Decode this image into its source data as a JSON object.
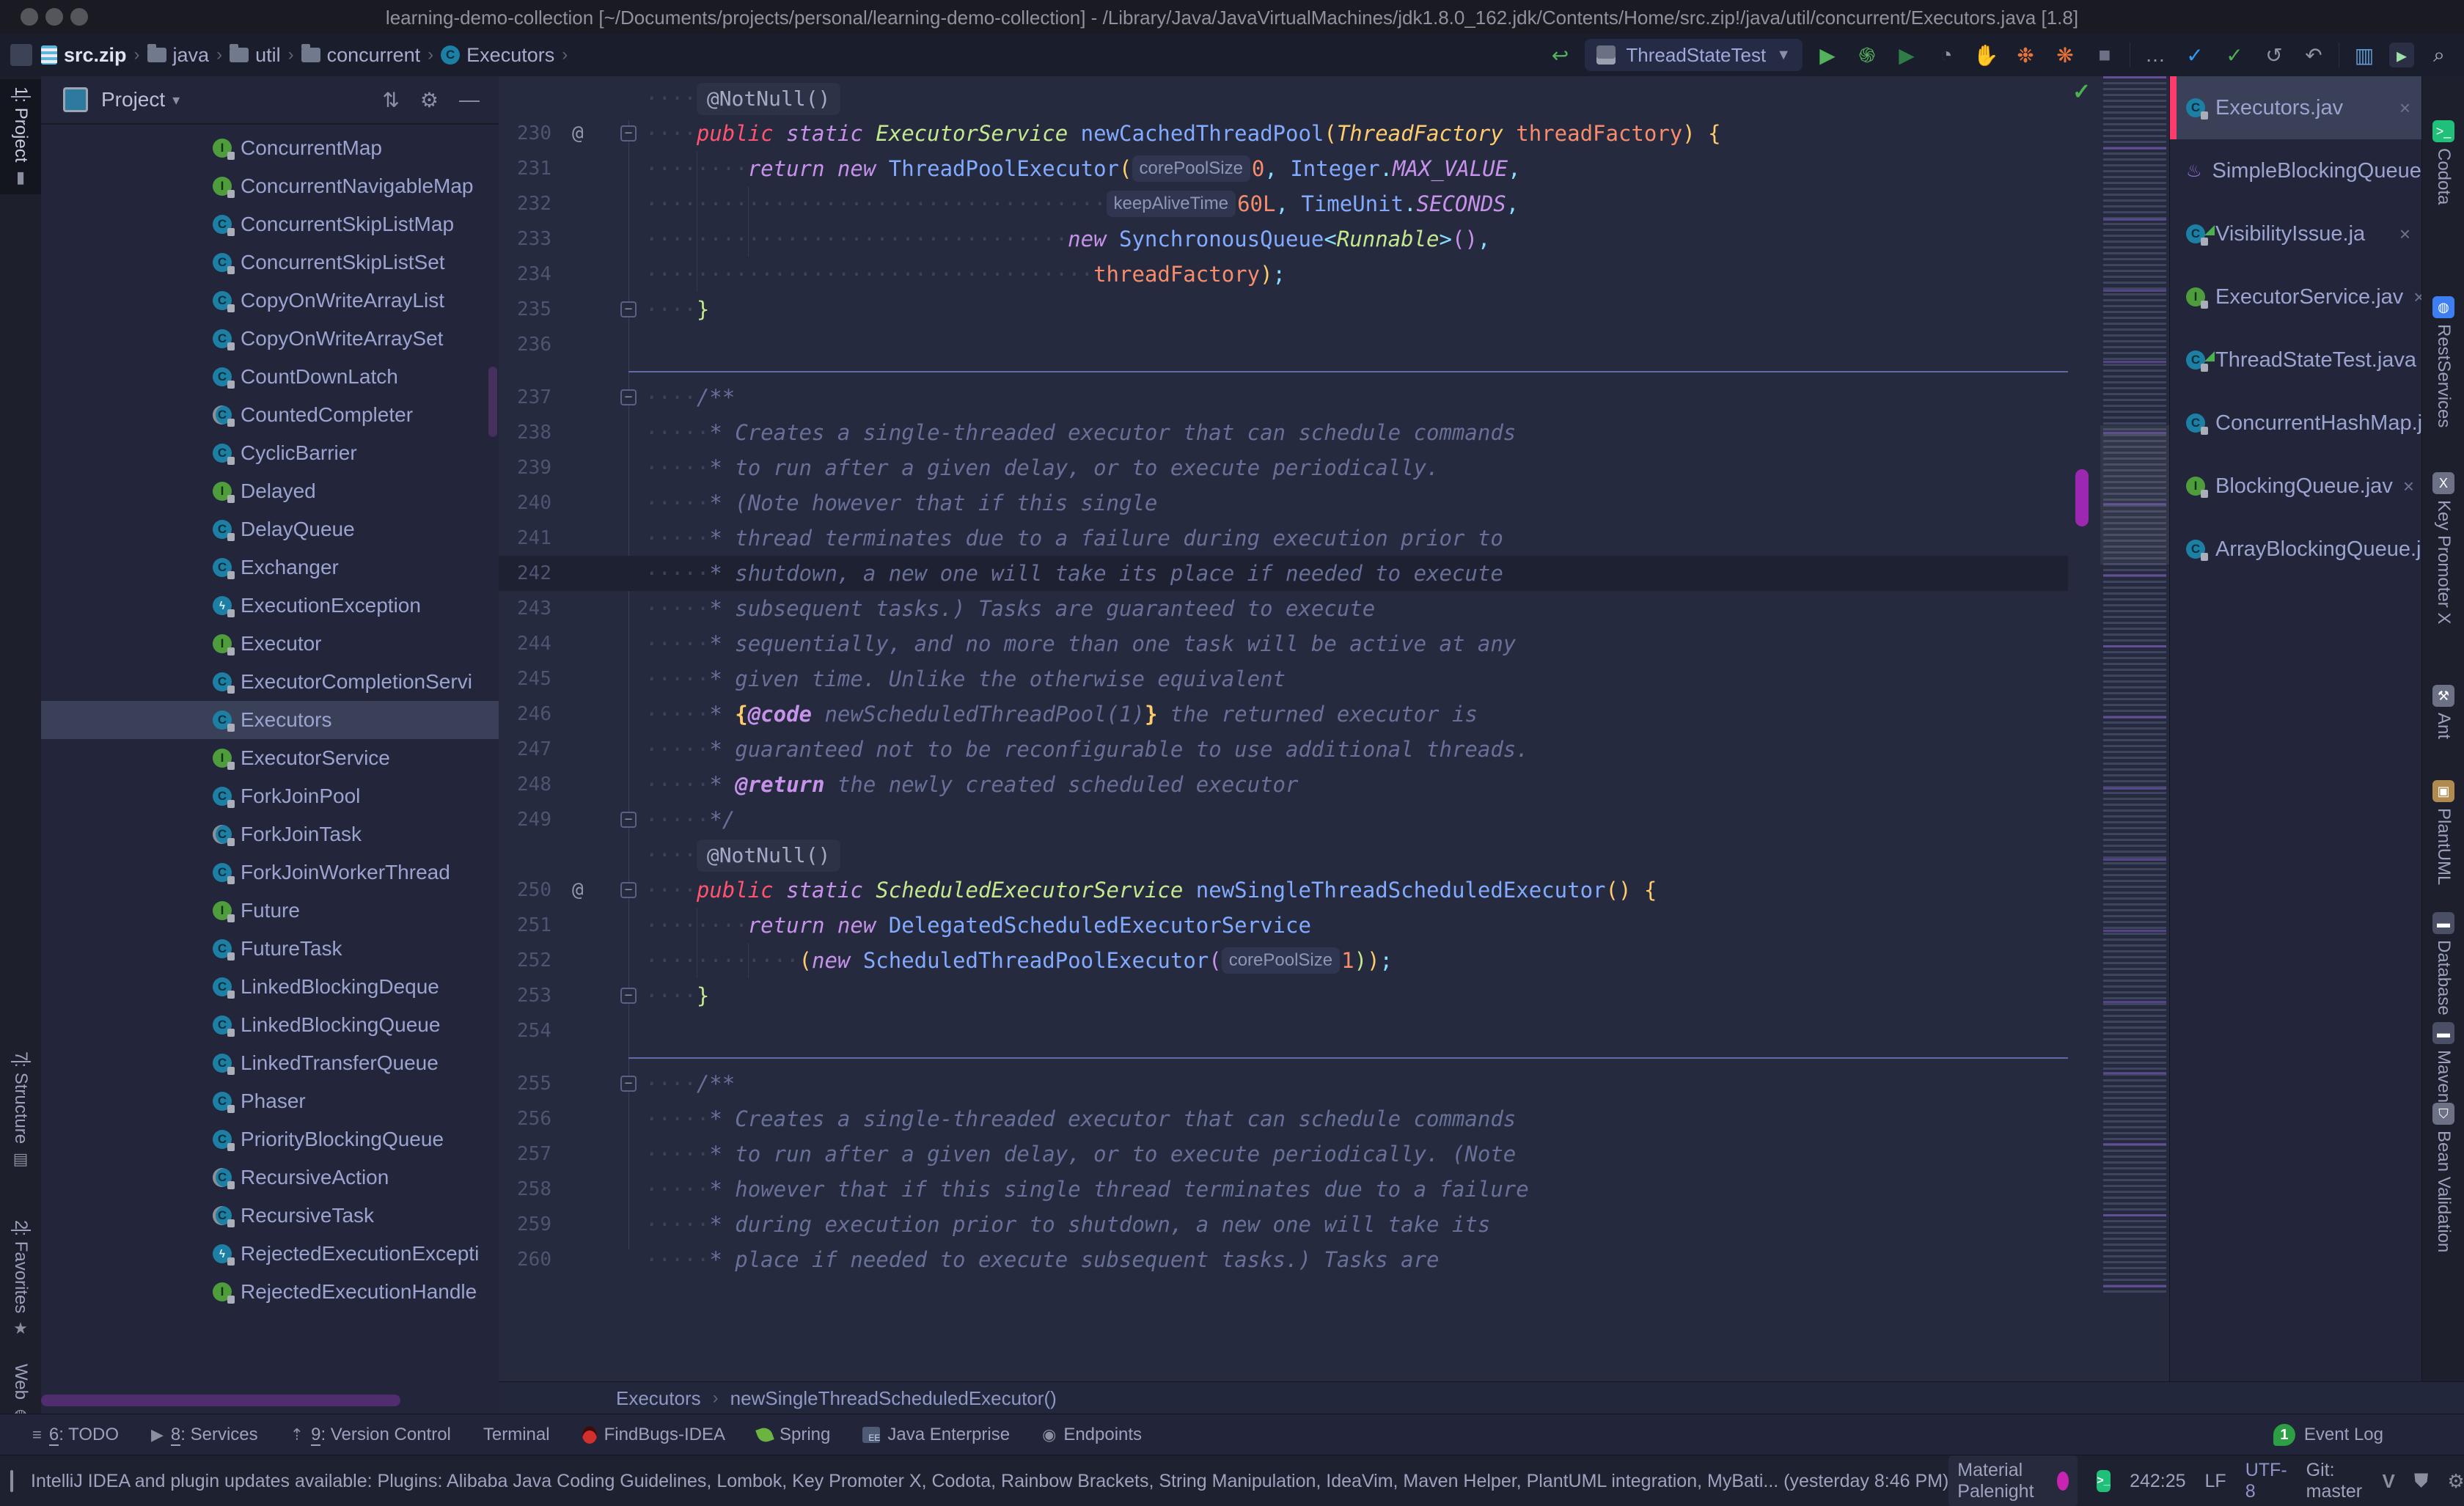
{
  "title_bar": {
    "title": "learning-demo-collection [~/Documents/projects/personal/learning-demo-collection] - /Library/Java/JavaVirtualMachines/jdk1.8.0_162.jdk/Contents/Home/src.zip!/java/util/concurrent/Executors.java [1.8]"
  },
  "breadcrumb_bar": {
    "crumbs": [
      {
        "label": "src.zip",
        "kind": "zip"
      },
      {
        "label": "java",
        "kind": "folder"
      },
      {
        "label": "util",
        "kind": "folder-arrow"
      },
      {
        "label": "concurrent",
        "kind": "folder"
      },
      {
        "label": "Executors",
        "kind": "class"
      }
    ],
    "run_config": "ThreadStateTest",
    "toolbar_icons": [
      "back-arrow",
      "run",
      "debug",
      "run-coverage",
      "profiler",
      "stop-hand",
      "profile-events",
      "profile-alloc",
      "stop",
      "sep",
      "more",
      "vim-check",
      "commit-check",
      "history",
      "rollback",
      "sep",
      "layout",
      "run-anything",
      "search"
    ]
  },
  "left_stripe": {
    "top": [
      {
        "num": "1",
        "label": ": Project",
        "icon": "project-folder-icon",
        "active": true
      }
    ],
    "bottom": [
      {
        "num": "7",
        "label": ": Structure",
        "icon": "structure-icon"
      },
      {
        "num": "2",
        "label": ": Favorites",
        "icon": "star-icon"
      },
      {
        "num": "",
        "label": "Web",
        "icon": "globe-icon"
      }
    ]
  },
  "project_panel": {
    "header": {
      "label": "Project",
      "icons": [
        "collapse-all-icon",
        "settings-icon",
        "hide-icon"
      ]
    },
    "tree": [
      {
        "label": "ConcurrentMap",
        "kind": "interface"
      },
      {
        "label": "ConcurrentNavigableMap",
        "kind": "interface"
      },
      {
        "label": "ConcurrentSkipListMap",
        "kind": "class"
      },
      {
        "label": "ConcurrentSkipListSet",
        "kind": "class"
      },
      {
        "label": "CopyOnWriteArrayList",
        "kind": "class"
      },
      {
        "label": "CopyOnWriteArraySet",
        "kind": "class"
      },
      {
        "label": "CountDownLatch",
        "kind": "class"
      },
      {
        "label": "CountedCompleter",
        "kind": "abstract"
      },
      {
        "label": "CyclicBarrier",
        "kind": "class"
      },
      {
        "label": "Delayed",
        "kind": "interface"
      },
      {
        "label": "DelayQueue",
        "kind": "class"
      },
      {
        "label": "Exchanger",
        "kind": "class"
      },
      {
        "label": "ExecutionException",
        "kind": "exception"
      },
      {
        "label": "Executor",
        "kind": "interface"
      },
      {
        "label": "ExecutorCompletionServi",
        "kind": "class"
      },
      {
        "label": "Executors",
        "kind": "class",
        "selected": true
      },
      {
        "label": "ExecutorService",
        "kind": "interface"
      },
      {
        "label": "ForkJoinPool",
        "kind": "class"
      },
      {
        "label": "ForkJoinTask",
        "kind": "abstract"
      },
      {
        "label": "ForkJoinWorkerThread",
        "kind": "class"
      },
      {
        "label": "Future",
        "kind": "interface"
      },
      {
        "label": "FutureTask",
        "kind": "class"
      },
      {
        "label": "LinkedBlockingDeque",
        "kind": "class"
      },
      {
        "label": "LinkedBlockingQueue",
        "kind": "class"
      },
      {
        "label": "LinkedTransferQueue",
        "kind": "class"
      },
      {
        "label": "Phaser",
        "kind": "class"
      },
      {
        "label": "PriorityBlockingQueue",
        "kind": "class"
      },
      {
        "label": "RecursiveAction",
        "kind": "abstract"
      },
      {
        "label": "RecursiveTask",
        "kind": "abstract"
      },
      {
        "label": "RejectedExecutionExcepti",
        "kind": "exception"
      },
      {
        "label": "RejectedExecutionHandle",
        "kind": "interface"
      }
    ]
  },
  "editor": {
    "rows": [
      {
        "ann": "@NotNull()",
        "ind": 4
      },
      {
        "n": "230",
        "g": 1,
        "f": 1,
        "ind": 4,
        "seg": [
          [
            "public ",
            "kw1"
          ],
          [
            "static ",
            "kw"
          ],
          [
            "ExecutorService ",
            "type"
          ],
          [
            "newCachedThreadPool",
            "m"
          ],
          [
            "(",
            "bry"
          ],
          [
            "ThreadFactory ",
            "ptype"
          ],
          [
            "threadFactory",
            "arg"
          ],
          [
            ") {",
            "bry"
          ]
        ]
      },
      {
        "n": "231",
        "ind": 8,
        "seg": [
          [
            "return new ",
            "kw"
          ],
          [
            "ThreadPoolExecutor",
            "cls"
          ],
          [
            "(",
            "bry"
          ],
          [
            "corePoolSize",
            "chip"
          ],
          [
            "0",
            "num"
          ],
          [
            ", ",
            "pun"
          ],
          [
            "Integer",
            "cls"
          ],
          [
            ".",
            "pun"
          ],
          [
            "MAX_VALUE",
            "kw"
          ],
          [
            ",",
            "pun"
          ]
        ]
      },
      {
        "n": "232",
        "ind": 36,
        "seg": [
          [
            "keepAliveTime",
            "chip"
          ],
          [
            "60L",
            "num"
          ],
          [
            ", ",
            "pun"
          ],
          [
            "TimeUnit",
            "cls"
          ],
          [
            ".",
            "pun"
          ],
          [
            "SECONDS",
            "kw"
          ],
          [
            ",",
            "pun"
          ]
        ]
      },
      {
        "n": "233",
        "ind": 33,
        "seg": [
          [
            "new ",
            "kw"
          ],
          [
            "SynchronousQueue",
            "cls"
          ],
          [
            "<",
            "pun"
          ],
          [
            "Runnable",
            "type"
          ],
          [
            ">",
            "pun"
          ],
          [
            "()",
            "prp"
          ],
          [
            ",",
            "pun"
          ]
        ]
      },
      {
        "n": "234",
        "ind": 35,
        "seg": [
          [
            "threadFactory",
            "arg"
          ],
          [
            ")",
            "bry"
          ],
          [
            ";",
            "pun"
          ]
        ]
      },
      {
        "n": "235",
        "f": 2,
        "ind": 4,
        "seg": [
          [
            "}",
            "brg"
          ]
        ]
      },
      {
        "n": "236"
      },
      {
        "n": "237",
        "f": 1,
        "sep": 1,
        "ind": 4,
        "seg": [
          [
            "/**",
            "cmt"
          ]
        ]
      },
      {
        "n": "238",
        "ind": 5,
        "seg": [
          [
            "* Creates a single-threaded executor that can schedule commands",
            "cmt"
          ]
        ]
      },
      {
        "n": "239",
        "ind": 5,
        "seg": [
          [
            "* to run after a given delay, or to execute periodically.",
            "cmt"
          ]
        ]
      },
      {
        "n": "240",
        "ind": 5,
        "seg": [
          [
            "* (Note however that if this single",
            "cmt"
          ]
        ]
      },
      {
        "n": "241",
        "ind": 5,
        "seg": [
          [
            "* thread terminates due to a failure during execution prior to",
            "cmt"
          ]
        ]
      },
      {
        "n": "242",
        "cur": 1,
        "ind": 5,
        "seg": [
          [
            "* shutdown, a new one will take its place if needed to execute",
            "cmt"
          ]
        ]
      },
      {
        "n": "243",
        "ind": 5,
        "seg": [
          [
            "* subsequent tasks.)  Tasks are guaranteed to execute",
            "cmt"
          ]
        ]
      },
      {
        "n": "244",
        "ind": 5,
        "seg": [
          [
            "* sequentially, and no more than one task will be active at any",
            "cmt"
          ]
        ]
      },
      {
        "n": "245",
        "ind": 5,
        "seg": [
          [
            "* given time. Unlike the otherwise equivalent",
            "cmt"
          ]
        ]
      },
      {
        "n": "246",
        "ind": 5,
        "seg": [
          [
            "* ",
            "cmt"
          ],
          [
            "{",
            "brb"
          ],
          [
            "@code",
            "tag"
          ],
          [
            " newScheduledThreadPool(1)",
            "cmt"
          ],
          [
            "}",
            "brb"
          ],
          [
            " the returned executor is",
            "cmt"
          ]
        ]
      },
      {
        "n": "247",
        "ind": 5,
        "seg": [
          [
            "* guaranteed not to be reconfigurable to use additional threads.",
            "cmt"
          ]
        ]
      },
      {
        "n": "248",
        "ind": 5,
        "seg": [
          [
            "* ",
            "cmt"
          ],
          [
            "@return",
            "tag"
          ],
          [
            " the newly created scheduled executor",
            "cmt"
          ]
        ]
      },
      {
        "n": "249",
        "f": 2,
        "ind": 5,
        "seg": [
          [
            "*/",
            "cmt"
          ]
        ]
      },
      {
        "ann": "@NotNull()",
        "ind": 4
      },
      {
        "n": "250",
        "g": 1,
        "f": 1,
        "ind": 4,
        "seg": [
          [
            "public ",
            "kw1"
          ],
          [
            "static ",
            "kw"
          ],
          [
            "ScheduledExecutorService ",
            "type"
          ],
          [
            "newSingleThreadScheduledExecutor",
            "m"
          ],
          [
            "() {",
            "bry"
          ]
        ]
      },
      {
        "n": "251",
        "ind": 8,
        "seg": [
          [
            "return new ",
            "kw"
          ],
          [
            "DelegatedScheduledExecutorService",
            "cls"
          ]
        ]
      },
      {
        "n": "252",
        "ind": 12,
        "seg": [
          [
            "(",
            "bry"
          ],
          [
            "new ",
            "kw"
          ],
          [
            "ScheduledThreadPoolExecutor",
            "cls"
          ],
          [
            "(",
            "prp"
          ],
          [
            "corePoolSize",
            "chip"
          ],
          [
            "1",
            "num"
          ],
          [
            ")",
            "brg"
          ],
          [
            ")",
            "bry"
          ],
          [
            ";",
            "pun"
          ]
        ]
      },
      {
        "n": "253",
        "f": 2,
        "ind": 4,
        "seg": [
          [
            "}",
            "brg"
          ]
        ]
      },
      {
        "n": "254"
      },
      {
        "n": "255",
        "f": 1,
        "sep": 1,
        "ind": 4,
        "seg": [
          [
            "/**",
            "cmt"
          ]
        ]
      },
      {
        "n": "256",
        "ind": 5,
        "seg": [
          [
            "* Creates a single-threaded executor that can schedule commands",
            "cmt"
          ]
        ]
      },
      {
        "n": "257",
        "ind": 5,
        "seg": [
          [
            "* to run after a given delay, or to execute periodically.  (Note",
            "cmt"
          ]
        ]
      },
      {
        "n": "258",
        "ind": 5,
        "seg": [
          [
            "* however that if this single thread terminates due to a failure",
            "cmt"
          ]
        ]
      },
      {
        "n": "259",
        "ind": 5,
        "seg": [
          [
            "* during execution prior to shutdown, a new one will take its",
            "cmt"
          ]
        ]
      },
      {
        "n": "260",
        "ind": 5,
        "seg": [
          [
            "* place if needed to execute subsequent tasks.)  Tasks are",
            "cmt"
          ]
        ]
      }
    ]
  },
  "open_files": [
    {
      "label": "Executors.jav",
      "kind": "class",
      "selected": true
    },
    {
      "label": "SimpleBlockingQueue.ja",
      "kind": "java"
    },
    {
      "label": "VisibilityIssue.ja",
      "kind": "class-run"
    },
    {
      "label": "ExecutorService.jav",
      "kind": "interface"
    },
    {
      "label": "ThreadStateTest.java",
      "kind": "class-run"
    },
    {
      "label": "ConcurrentHashMap.jav",
      "kind": "class"
    },
    {
      "label": "BlockingQueue.jav",
      "kind": "interface"
    },
    {
      "label": "ArrayBlockingQueue.jav",
      "kind": "class"
    }
  ],
  "right_stripe": [
    "Codota",
    "RestServices",
    "Key Promoter X",
    "Ant",
    "PlantUML",
    "Database",
    "Maven",
    "Bean Validation"
  ],
  "editor_breadcrumb": [
    "Executors",
    "newSingleThreadScheduledExecutor()"
  ],
  "bottom_stripe": {
    "items": [
      {
        "num": "6",
        "label": "TODO",
        "icon": "todo-list-icon"
      },
      {
        "num": "8",
        "label": "Services",
        "icon": "services-icon"
      },
      {
        "num": "9",
        "label": "Version Control",
        "icon": "vcs-icon"
      },
      {
        "num": "",
        "label": "Terminal",
        "icon": ""
      },
      {
        "num": "",
        "label": "FindBugs-IDEA",
        "icon": "bug-icon"
      },
      {
        "num": "",
        "label": "Spring",
        "icon": "leaf-icon"
      },
      {
        "num": "",
        "label": "Java Enterprise",
        "icon": "ee-icon"
      },
      {
        "num": "",
        "label": "Endpoints",
        "icon": "endpoints-icon"
      }
    ],
    "event_log": "Event Log"
  },
  "status_bar": {
    "message": "IntelliJ IDEA and plugin updates available: Plugins: Alibaba Java Coding Guidelines, Lombok, Key Promoter X, Codota, Rainbow Brackets, String Manipulation, IdeaVim, Maven Helper, PlantUML integration, MyBati... (yesterday 8:46 PM)",
    "theme": "Material Palenight",
    "position": "242:25",
    "line_separator": "LF",
    "encoding": "UTF-8",
    "git": "Git: master"
  },
  "colors": {
    "accent_pink": "#ff3b6b",
    "run_green": "#4caf50",
    "scroll_purple": "#9c27b0",
    "selection": "#3a4057",
    "editor_bg": "#252a3e",
    "panel_bg": "#23263a"
  },
  "icons": {
    "gear-icon": "⚙",
    "collapse-all-icon": "⇅",
    "hide-icon": "—",
    "chevron-icon": "›",
    "close-icon": "×",
    "check-icon": "✓",
    "search-icon": "⌕",
    "star-icon": "★",
    "structure-icon": "▤",
    "globe-icon": "◍",
    "folder-icon": "▮",
    "history-icon": "↺",
    "rollback-icon": "↶",
    "more-icon": "…",
    "run-icon": "▶",
    "stop-icon": "■",
    "todo-list-icon": "≡"
  }
}
